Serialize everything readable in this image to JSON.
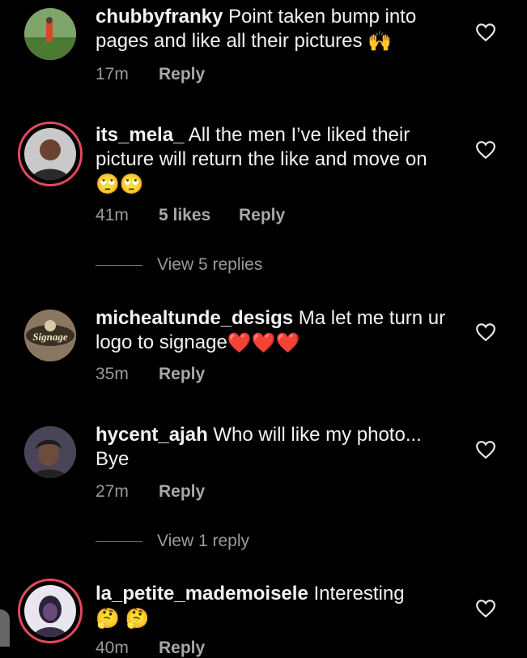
{
  "comments": [
    {
      "username": "chubbyfranky",
      "text": "Point taken bump into pages and  like all their pictures",
      "emoji": "🙌",
      "time": "17m",
      "likes": "",
      "reply": "Reply",
      "view_replies": ""
    },
    {
      "username": "its_mela_",
      "text": "All the men I’ve liked their picture will return the like and move on",
      "emoji": "🙄🙄",
      "time": "41m",
      "likes": "5 likes",
      "reply": "Reply",
      "view_replies": "View 5 replies"
    },
    {
      "username": "michealtunde_desigs",
      "text": "Ma let me turn ur logo to signage",
      "emoji": "❤️❤️❤️",
      "time": "35m",
      "likes": "",
      "reply": "Reply",
      "view_replies": "",
      "avatar_text": "Signage"
    },
    {
      "username": "hycent_ajah",
      "text": "Who will like my photo... Bye",
      "emoji": "",
      "time": "27m",
      "likes": "",
      "reply": "Reply",
      "view_replies": "View 1 reply"
    },
    {
      "username": "la_petite_mademoisele",
      "text": "Interesting",
      "emoji": "🤔 🤔",
      "time": "40m",
      "likes": "",
      "reply": "Reply",
      "view_replies": ""
    }
  ],
  "colors": {
    "background": "#000000",
    "text": "#f2f2f2",
    "muted": "#9a9a9a",
    "story_ring": "#e2485e"
  }
}
